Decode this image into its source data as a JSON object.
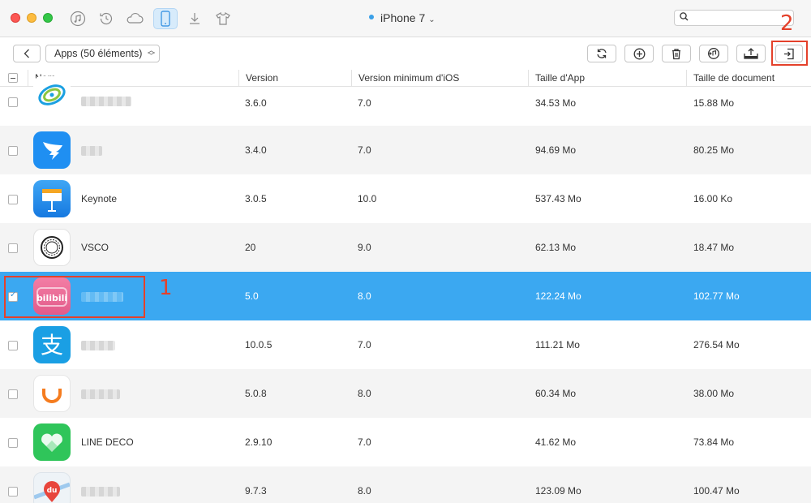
{
  "titlebar": {
    "device_name": "iPhone 7",
    "icons": [
      "music-icon",
      "history-icon",
      "cloud-icon",
      "phone-icon",
      "download-icon",
      "tshirt-icon"
    ]
  },
  "search": {
    "placeholder": "",
    "value": ""
  },
  "toolbar": {
    "apps_label": "Apps (50 éléments)",
    "buttons": [
      "refresh-icon",
      "add-icon",
      "trash-icon",
      "to-itunes-icon",
      "to-device-icon",
      "export-to-computer-icon"
    ]
  },
  "annotations": {
    "marker_1": "1",
    "marker_2": "2",
    "color": "#e4412b"
  },
  "table": {
    "columns": [
      "Nom",
      "Version",
      "Version minimum d'iOS",
      "Taille d'App",
      "Taille de document"
    ],
    "rows": [
      {
        "name": "",
        "version": "3.6.0",
        "min_ios": "7.0",
        "app_size": "34.53 Mo",
        "doc_size": "15.88 Mo",
        "icon": "china-mobile-icon",
        "checked": false
      },
      {
        "name": "",
        "version": "3.4.0",
        "min_ios": "7.0",
        "app_size": "94.69 Mo",
        "doc_size": "80.25 Mo",
        "icon": "dingtalk-icon",
        "checked": false
      },
      {
        "name": "Keynote",
        "version": "3.0.5",
        "min_ios": "10.0",
        "app_size": "537.43 Mo",
        "doc_size": "16.00 Ko",
        "icon": "keynote-icon",
        "checked": false
      },
      {
        "name": "VSCO",
        "version": "20",
        "min_ios": "9.0",
        "app_size": "62.13 Mo",
        "doc_size": "18.47 Mo",
        "icon": "vsco-icon",
        "checked": false
      },
      {
        "name": "",
        "version": "5.0",
        "min_ios": "8.0",
        "app_size": "122.24 Mo",
        "doc_size": "102.77 Mo",
        "icon": "bilibili-icon",
        "checked": true
      },
      {
        "name": "",
        "version": "10.0.5",
        "min_ios": "7.0",
        "app_size": "111.21 Mo",
        "doc_size": "276.54 Mo",
        "icon": "alipay-icon",
        "checked": false
      },
      {
        "name": "",
        "version": "5.0.8",
        "min_ios": "8.0",
        "app_size": "60.34 Mo",
        "doc_size": "38.00 Mo",
        "icon": "didi-icon",
        "checked": false
      },
      {
        "name": "LINE DECO",
        "version": "2.9.10",
        "min_ios": "7.0",
        "app_size": "41.62 Mo",
        "doc_size": "73.84 Mo",
        "icon": "line-deco-icon",
        "checked": false
      },
      {
        "name": "",
        "version": "9.7.3",
        "min_ios": "8.0",
        "app_size": "123.09 Mo",
        "doc_size": "100.47 Mo",
        "icon": "baidu-maps-icon",
        "checked": false
      }
    ]
  }
}
